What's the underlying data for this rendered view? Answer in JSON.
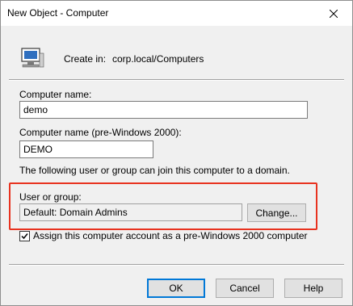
{
  "window": {
    "title": "New Object - Computer"
  },
  "header": {
    "create_in_label": "Create in:",
    "create_in_value": "corp.local/Computers"
  },
  "computer_name": {
    "label": "Computer name:",
    "value": "demo"
  },
  "pre_win2000": {
    "label": "Computer name (pre-Windows 2000):",
    "value": "DEMO"
  },
  "join_note": "The following user or group can join this computer to a domain.",
  "user_group": {
    "label": "User or group:",
    "value": "Default: Domain Admins",
    "change_label": "Change..."
  },
  "assign_checkbox": {
    "label": "Assign this computer account as a pre-Windows 2000 computer",
    "checked": true
  },
  "buttons": {
    "ok": "OK",
    "cancel": "Cancel",
    "help": "Help"
  },
  "colors": {
    "highlight": "#e8321f",
    "accent": "#0078d7"
  },
  "icons": {
    "close": "close-icon",
    "computer": "computer-icon",
    "check": "checkmark-icon"
  }
}
